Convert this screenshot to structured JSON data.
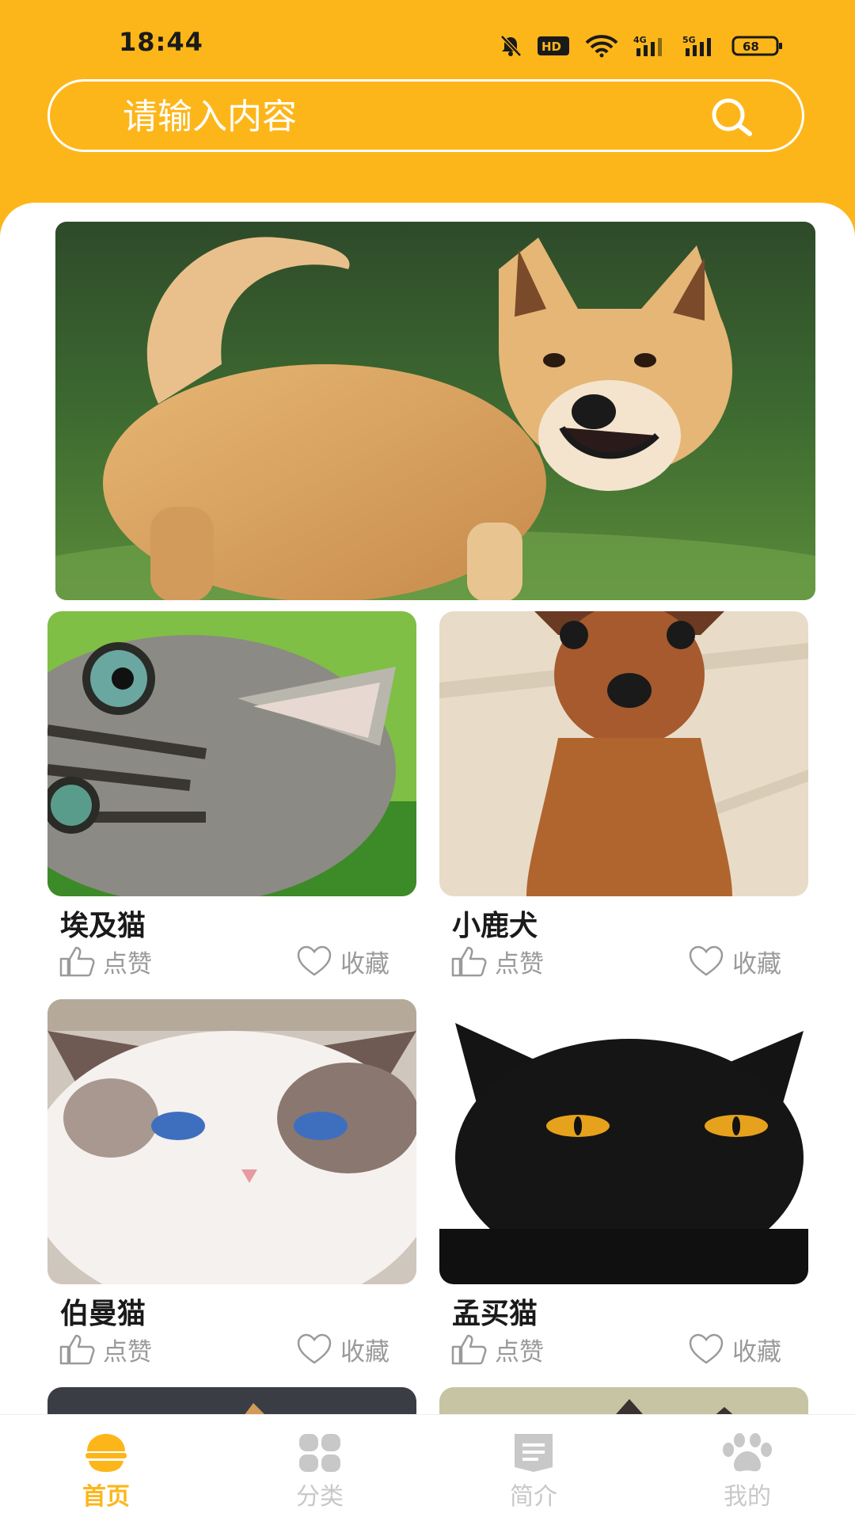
{
  "status_bar": {
    "time": "18:44",
    "network_4g": "4G",
    "network_5g": "5G",
    "hd_label": "HD",
    "battery": "68"
  },
  "search": {
    "placeholder": "请输入内容",
    "icon": "search-icon"
  },
  "banner": {
    "image": "shiba-dog-photo"
  },
  "pets": [
    {
      "name": "埃及猫",
      "image": "tabby-kitten-photo",
      "like_label": "点赞",
      "fav_label": "收藏"
    },
    {
      "name": "小鹿犬",
      "image": "min-pin-dog-photo",
      "like_label": "点赞",
      "fav_label": "收藏"
    },
    {
      "name": "伯曼猫",
      "image": "birman-cat-photo",
      "like_label": "点赞",
      "fav_label": "收藏"
    },
    {
      "name": "孟买猫",
      "image": "bombay-cat-photo",
      "like_label": "点赞",
      "fav_label": "收藏"
    }
  ],
  "bottom_nav": {
    "items": [
      {
        "label": "首页",
        "icon": "home-icon",
        "active": true
      },
      {
        "label": "分类",
        "icon": "category-icon",
        "active": false
      },
      {
        "label": "简介",
        "icon": "intro-icon",
        "active": false
      },
      {
        "label": "我的",
        "icon": "paw-icon",
        "active": false
      }
    ]
  },
  "colors": {
    "brand": "#FDB61A",
    "muted": "#9a9a9a",
    "nav_inactive": "#c8c8c8"
  }
}
